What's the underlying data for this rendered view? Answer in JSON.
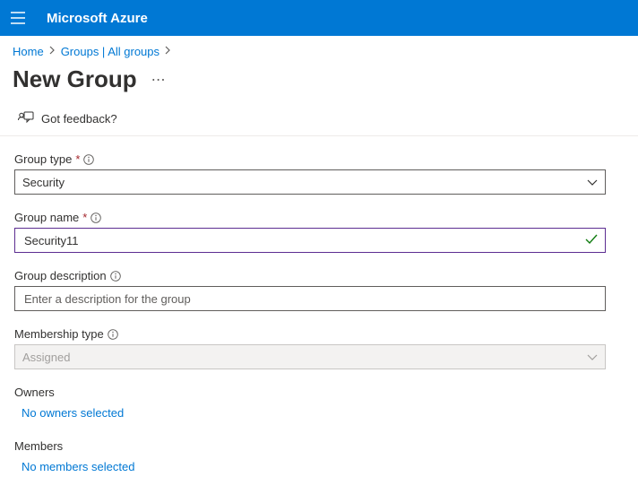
{
  "topbar": {
    "brand": "Microsoft Azure"
  },
  "breadcrumb": {
    "home": "Home",
    "groups": "Groups | All groups"
  },
  "title": "New Group",
  "feedback": "Got feedback?",
  "form": {
    "group_type": {
      "label": "Group type",
      "value": "Security"
    },
    "group_name": {
      "label": "Group name",
      "value": "Security11"
    },
    "group_description": {
      "label": "Group description",
      "placeholder": "Enter a description for the group",
      "value": ""
    },
    "membership_type": {
      "label": "Membership type",
      "value": "Assigned"
    }
  },
  "owners": {
    "label": "Owners",
    "link": "No owners selected"
  },
  "members": {
    "label": "Members",
    "link": "No members selected"
  }
}
